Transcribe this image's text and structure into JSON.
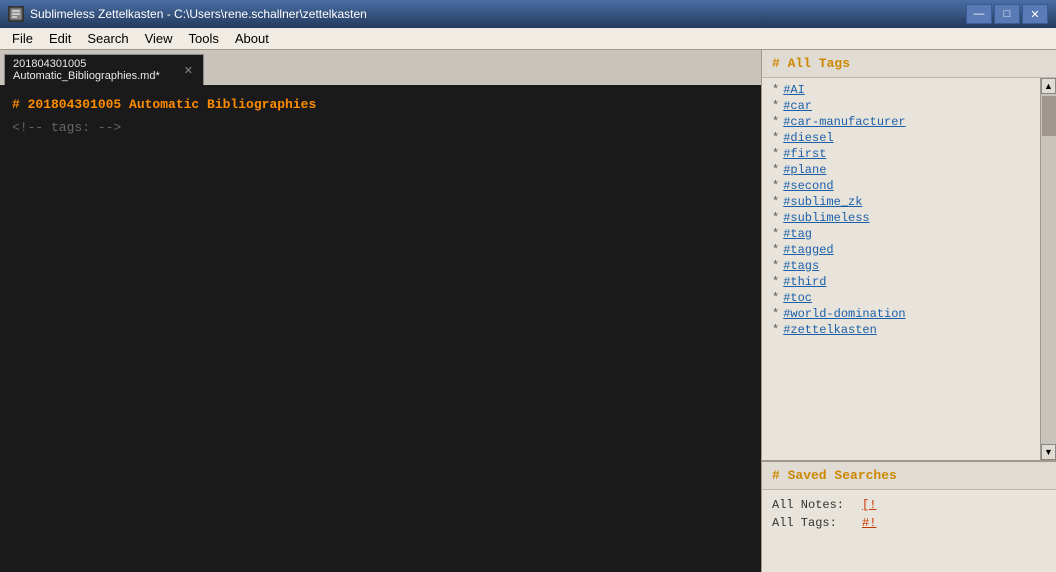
{
  "titlebar": {
    "icon": "☰",
    "title": "Sublimeless Zettelkasten - C:\\Users\\rene.schallner\\zettelkasten",
    "minimize": "—",
    "maximize": "□",
    "close": "✕"
  },
  "menubar": {
    "items": [
      {
        "label": "File"
      },
      {
        "label": "Edit"
      },
      {
        "label": "Search"
      },
      {
        "label": "View"
      },
      {
        "label": "Tools"
      },
      {
        "label": "About"
      }
    ]
  },
  "tabs": [
    {
      "name": "201804301005 Automatic_Bibliographies.md*",
      "active": true
    }
  ],
  "editor": {
    "heading": "# 201804301005 Automatic Bibliographies",
    "tags_comment": "<!-- tags: -->"
  },
  "sidebar": {
    "all_tags_header": "# All Tags",
    "tags": [
      "#AI",
      "#car",
      "#car-manufacturer",
      "#diesel",
      "#first",
      "#plane",
      "#second",
      "#sublime_zk",
      "#sublimeless",
      "#tag",
      "#tagged",
      "#tags",
      "#third",
      "#toc",
      "#world-domination",
      "#zettelkasten"
    ],
    "saved_searches_header": "# Saved Searches",
    "saved_searches": [
      {
        "label": "All Notes:",
        "link": "[!"
      },
      {
        "label": "All Tags:",
        "link": "#!"
      }
    ]
  }
}
